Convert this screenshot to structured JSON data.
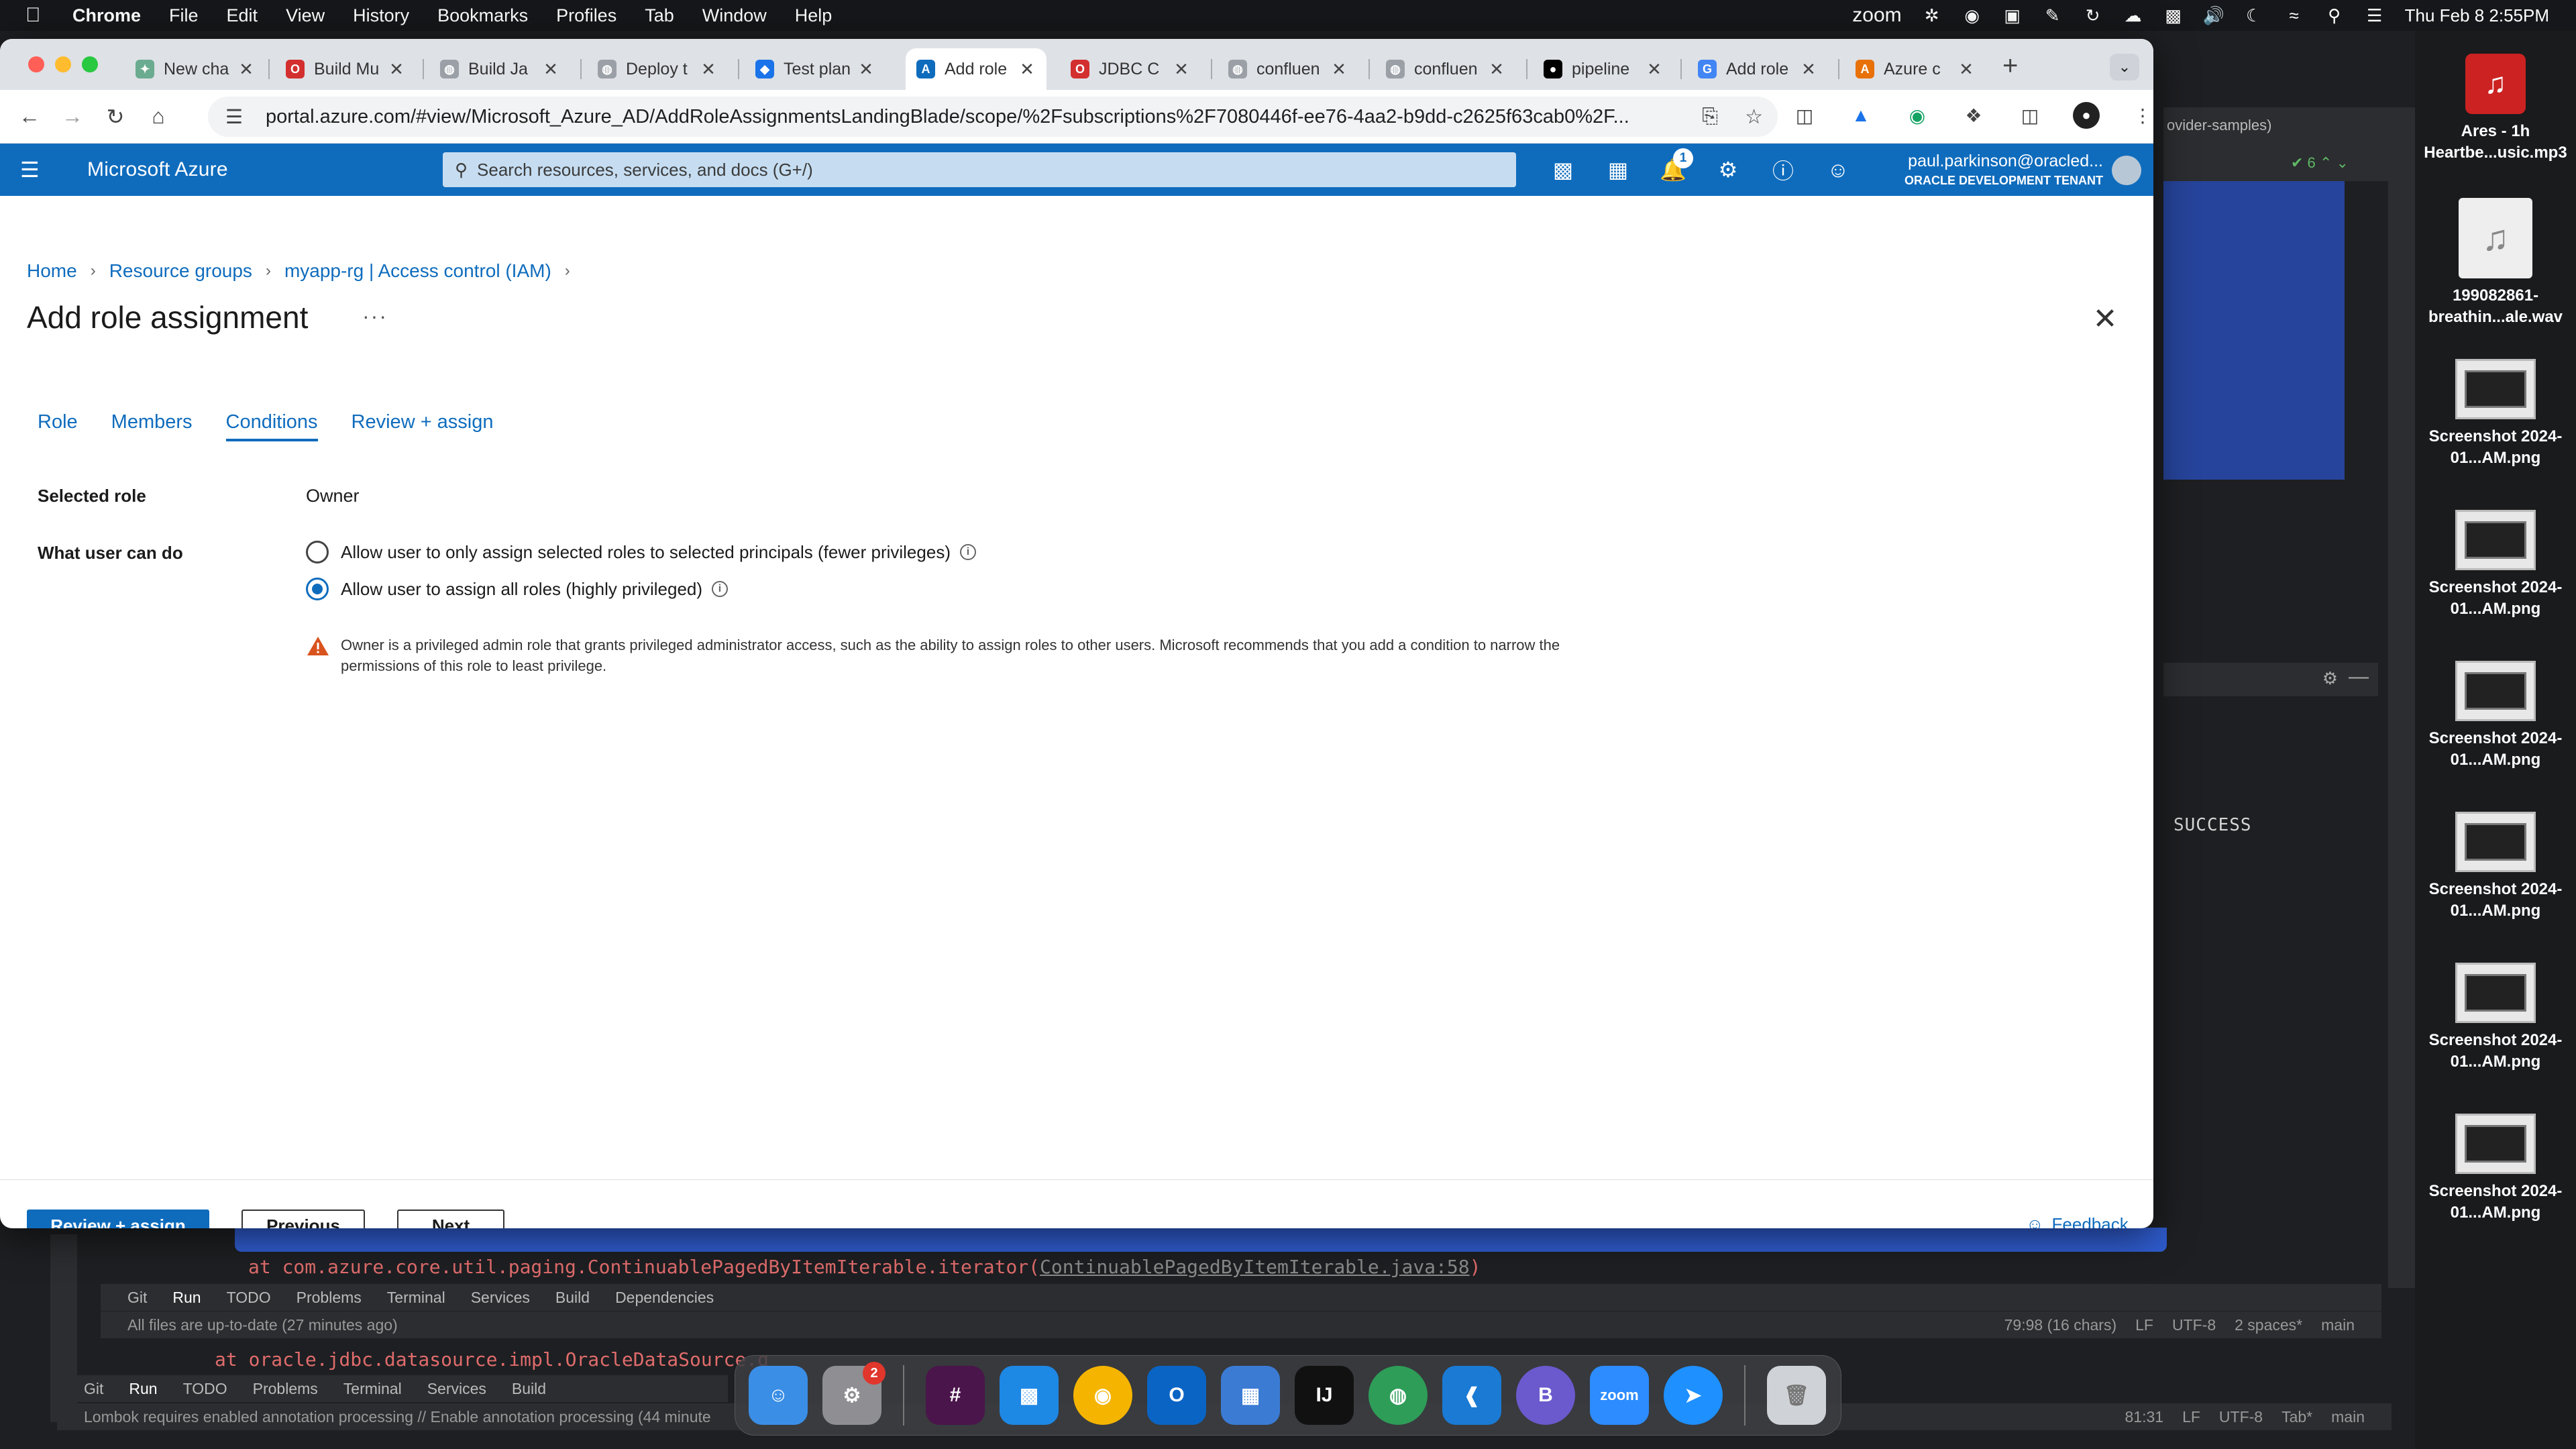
{
  "menubar": {
    "app": "Chrome",
    "items": [
      "File",
      "Edit",
      "View",
      "History",
      "Bookmarks",
      "Profiles",
      "Tab",
      "Window",
      "Help"
    ],
    "zoom_label": "zoom",
    "datetime": "Thu Feb 8  2:55PM"
  },
  "browser": {
    "tabs": [
      {
        "title": "New cha",
        "favicon_color": "#6bab8f"
      },
      {
        "title": "Build Mu",
        "favicon_color": "#d32f2f"
      },
      {
        "title": "Build Ja",
        "favicon_color": "#9aa0a6"
      },
      {
        "title": "Deploy t",
        "favicon_color": "#9aa0a6"
      },
      {
        "title": "Test plan",
        "favicon_color": "#1a73e8"
      },
      {
        "title": "Add role",
        "favicon_color": "#0f6cbd"
      },
      {
        "title": "JDBC C",
        "favicon_color": "#d32f2f"
      },
      {
        "title": "confluen",
        "favicon_color": "#9aa0a6"
      },
      {
        "title": "confluen",
        "favicon_color": "#9aa0a6"
      },
      {
        "title": "pipeline",
        "favicon_color": "#000000"
      },
      {
        "title": "Add role",
        "favicon_color": "#4285f4"
      },
      {
        "title": "Azure c",
        "favicon_color": "#e8710a"
      }
    ],
    "url": "portal.azure.com/#view/Microsoft_Azure_AD/AddRoleAssignmentsLandingBlade/scope/%2Fsubscriptions%2F7080446f-ee76-4aa2-b9dd-c2625f63cab0%2F..."
  },
  "azure": {
    "brand": "Microsoft Azure",
    "search_placeholder": "Search resources, services, and docs (G+/)",
    "notification_count": "1",
    "user_email": "paul.parkinson@oracled...",
    "tenant": "ORACLE DEVELOPMENT TENANT",
    "brand_color": "#0f6cbd"
  },
  "breadcrumb": [
    "Home",
    "Resource groups",
    "myapp-rg | Access control (IAM)"
  ],
  "page": {
    "title": "Add role assignment",
    "more": "···"
  },
  "wizard_tabs": [
    "Role",
    "Members",
    "Conditions",
    "Review + assign"
  ],
  "active_tab": "Conditions",
  "form": {
    "selected_role_label": "Selected role",
    "selected_role_value": "Owner",
    "what_user_can_do_label": "What user can do",
    "options": [
      {
        "label": "Allow user to only assign selected roles to selected principals (fewer privileges)",
        "checked": false
      },
      {
        "label": "Allow user to assign all roles (highly privileged)",
        "checked": true
      }
    ],
    "warning": "Owner is a privileged admin role that grants privileged administrator access, such as the ability to assign roles to other users. Microsoft recommends that you add a condition to narrow the permissions of this role to least privilege."
  },
  "footer": {
    "review_assign": "Review + assign",
    "previous": "Previous",
    "next": "Next",
    "feedback": "Feedback"
  },
  "ide": {
    "right_tool_text": "ovider-samples)",
    "success": "SUCCESS",
    "stacktrace_prefix": "at com.azure.core.util.paging.ContinuablePagedByItemIterable.iterator(",
    "stacktrace_link": "ContinuablePagedByItemIterable.java:58",
    "stacktrace_suffix": ")",
    "stacktrace2": "at oracle.jdbc.datasource.impl.OracleDataSource.g",
    "toolbar1": [
      "Git",
      "Run",
      "TODO",
      "Problems",
      "Terminal",
      "Services",
      "Build",
      "Dependencies"
    ],
    "status1": "All files are up-to-date (27 minutes ago)",
    "status1_right": [
      "79:98 (16 chars)",
      "LF",
      "UTF-8",
      "2 spaces*",
      "main"
    ],
    "toolbar2": [
      "Git",
      "Run",
      "TODO",
      "Problems",
      "Terminal",
      "Services",
      "Build"
    ],
    "status2": "Lombok requires enabled annotation processing // Enable annotation processing (44 minute",
    "status2_right": [
      "81:31",
      "LF",
      "UTF-8",
      "Tab*",
      "main"
    ]
  },
  "desktop": [
    {
      "label": "Ares - 1h Heartbe...usic.mp3"
    },
    {
      "label": "199082861-breathin...ale.wav"
    },
    {
      "label": "Screenshot 2024-01...AM.png"
    },
    {
      "label": "Screenshot 2024-01...AM.png"
    },
    {
      "label": "Screenshot 2024-01...AM.png"
    },
    {
      "label": "Screenshot 2024-01...AM.png"
    },
    {
      "label": "Screenshot 2024-01...AM.png"
    },
    {
      "label": "Screenshot 2024-01...AM.png"
    }
  ],
  "dock": {
    "settings_badge": "2",
    "zoom_label": "zoom"
  }
}
